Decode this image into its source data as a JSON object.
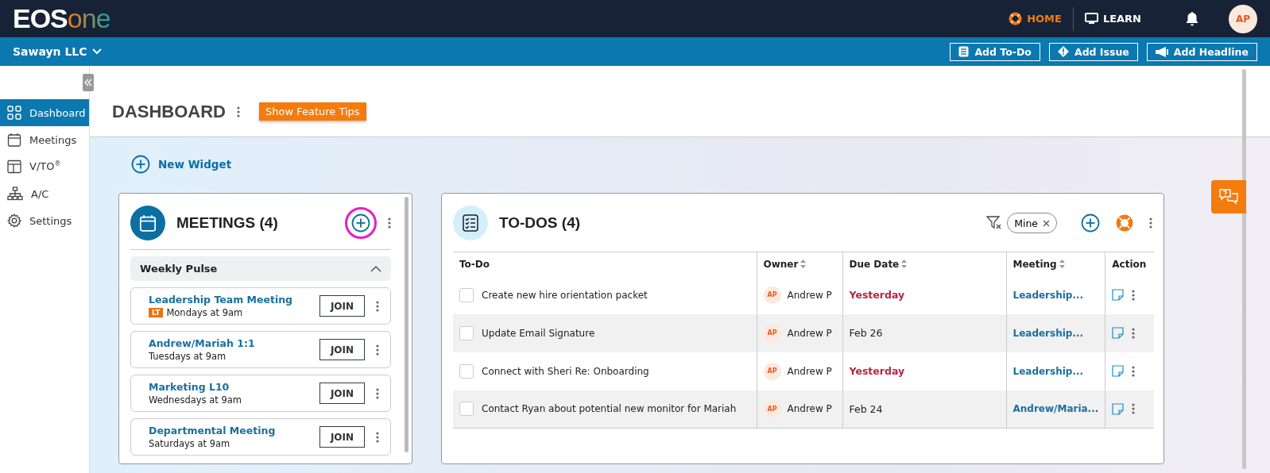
{
  "topbar": {
    "logo": {
      "text": "EOS",
      "accent": "one"
    },
    "nav": [
      {
        "label": "HOME",
        "selected": true,
        "kind": "home"
      },
      {
        "label": "LEARN",
        "selected": false,
        "kind": "learn"
      }
    ],
    "avatar": "AP"
  },
  "orgbar": {
    "org": "Sawayn LLC",
    "actions": [
      {
        "label": "Add To-Do",
        "kind": "todo"
      },
      {
        "label": "Add Issue",
        "kind": "issue"
      },
      {
        "label": "Add Headline",
        "kind": "headline"
      }
    ]
  },
  "sidebar": {
    "items": [
      {
        "label": "Dashboard",
        "kind": "grid",
        "selected": true
      },
      {
        "label": "Meetings",
        "kind": "calendar",
        "selected": false
      },
      {
        "label": "V/TO$^{®}$",
        "kind": "vto",
        "selected": false
      },
      {
        "label": "A/C",
        "kind": "org",
        "selected": false
      },
      {
        "label": "Settings",
        "kind": "gear",
        "selected": false
      }
    ]
  },
  "header": {
    "title": "DASHBOARD",
    "tips_button": "Show Feature Tips"
  },
  "new_widget": "New Widget",
  "meetings": {
    "title": "MEETINGS (4)",
    "group": {
      "label": "Weekly Pulse",
      "expanded": true
    },
    "items": [
      {
        "name": "Leadership Team Meeting",
        "tag": "LT",
        "schedule": "Mondays at 9am",
        "button": "JOIN"
      },
      {
        "name": "Andrew/Mariah 1:1",
        "schedule": "Tuesdays at 9am",
        "button": "JOIN"
      },
      {
        "name": "Marketing L10",
        "schedule": "Wednesdays at 9am",
        "button": "JOIN"
      },
      {
        "name": "Departmental Meeting",
        "schedule": "Saturdays at 9am",
        "button": "JOIN"
      }
    ]
  },
  "todos": {
    "title": "TO-DOS (4)",
    "filter_chip": "Mine",
    "columns": [
      {
        "label": "To-Do",
        "sortable": false
      },
      {
        "label": "Owner",
        "sortable": true
      },
      {
        "label": "Due Date",
        "sortable": true
      },
      {
        "label": "Meeting",
        "sortable": true
      },
      {
        "label": "Action",
        "sortable": false
      }
    ],
    "rows": [
      {
        "checked": false,
        "todo": "Create new hire orientation packet",
        "owner_initials": "AP",
        "owner": "Andrew P",
        "due": "Yesterday",
        "overdue": true,
        "meeting": "Leadership..."
      },
      {
        "checked": false,
        "todo": "Update Email Signature",
        "owner_initials": "AP",
        "owner": "Andrew P",
        "due": "Feb 26",
        "overdue": false,
        "meeting": "Leadership..."
      },
      {
        "checked": false,
        "todo": "Connect with Sheri Re: Onboarding",
        "owner_initials": "AP",
        "owner": "Andrew P",
        "due": "Yesterday",
        "overdue": true,
        "meeting": "Leadership..."
      },
      {
        "checked": false,
        "todo": "Contact Ryan about potential new monitor for Mariah",
        "owner_initials": "AP",
        "owner": "Andrew P",
        "due": "Feb 24",
        "overdue": false,
        "meeting": "Andrew/Maria..."
      }
    ]
  }
}
